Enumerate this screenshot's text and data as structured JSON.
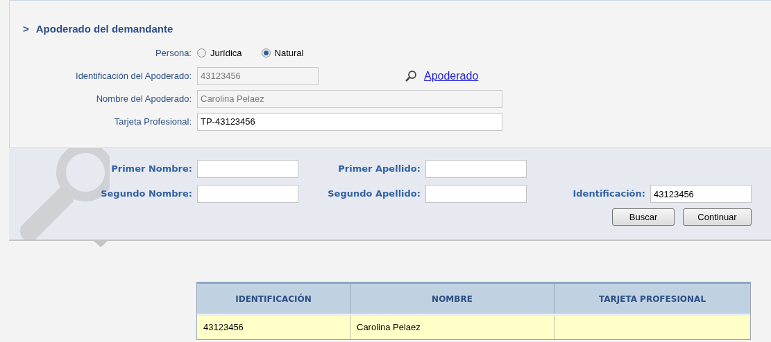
{
  "section_title": {
    "marker": ">",
    "text": "Apoderado del demandante"
  },
  "persona": {
    "label": "Persona:",
    "options": [
      {
        "label": "Jurídica",
        "selected": false
      },
      {
        "label": "Natural",
        "selected": true
      }
    ]
  },
  "identificacion": {
    "label": "Identificación del Apoderado:",
    "value": "43123456",
    "disabled": true,
    "link": "Apoderado"
  },
  "nombre": {
    "label": "Nombre del Apoderado:",
    "value": "Carolina Pelaez",
    "disabled": true
  },
  "tarjeta": {
    "label": "Tarjeta Profesional:",
    "value": "TP-43123456",
    "disabled": false
  },
  "search_panel": {
    "fields": [
      {
        "label": "Primer Nombre:"
      },
      {
        "label": "Primer Apellido:"
      },
      {
        "label": "Segundo Nombre:"
      },
      {
        "label": "Segundo Apellido:"
      },
      {
        "label": "Identificación:",
        "value": "43123456"
      }
    ],
    "buttons": [
      "Buscar",
      "Continuar"
    ]
  },
  "table": {
    "columns": [
      "IDENTIFICACIÓN",
      "NOMBRE",
      "TARJETA PROFESIONAL"
    ],
    "rows": [
      {
        "cells": [
          "43123456",
          "Carolina Pelaez",
          ""
        ],
        "selected": true
      }
    ]
  }
}
